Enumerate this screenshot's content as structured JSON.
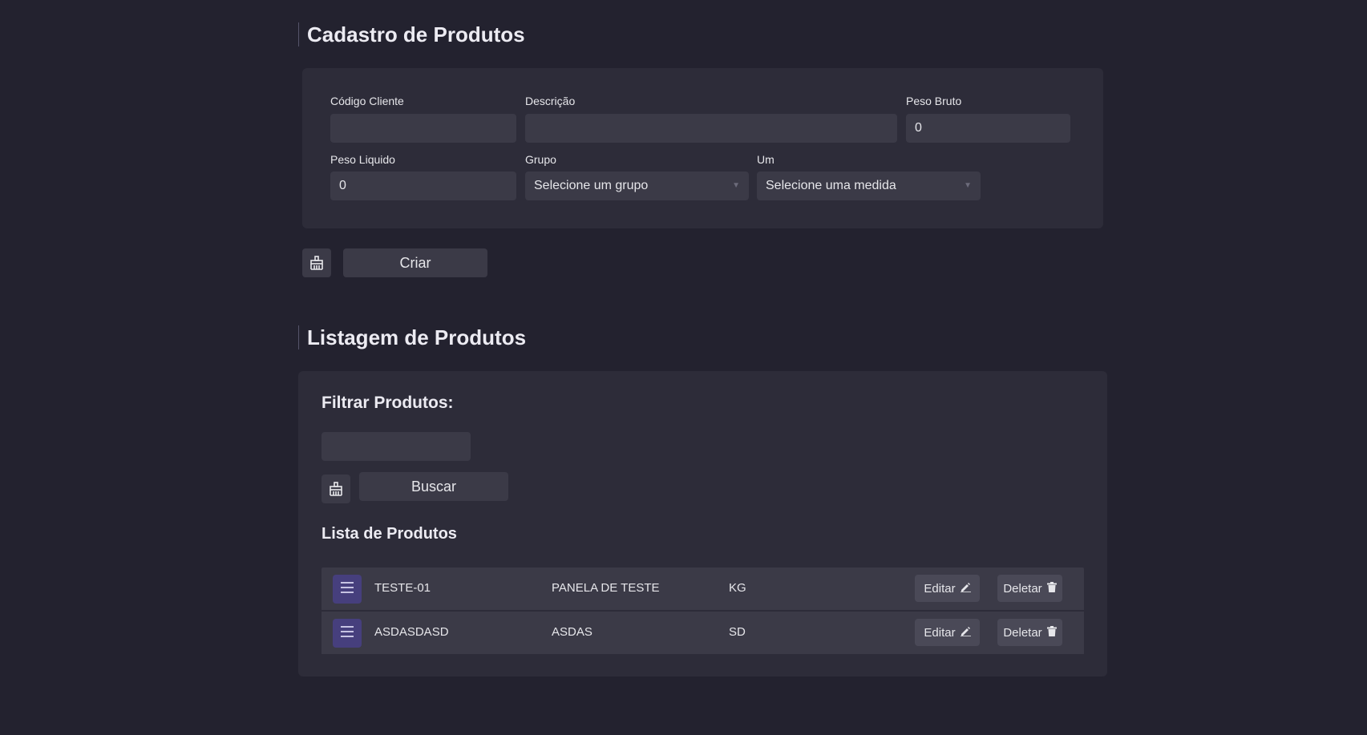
{
  "cadastro": {
    "title": "Cadastro de Produtos",
    "fields": {
      "codigo_cliente": {
        "label": "Código Cliente",
        "value": ""
      },
      "descricao": {
        "label": "Descrição",
        "value": ""
      },
      "peso_bruto": {
        "label": "Peso Bruto",
        "value": "0"
      },
      "peso_liquido": {
        "label": "Peso Liquido",
        "value": "0"
      },
      "grupo": {
        "label": "Grupo",
        "selected": "Selecione um grupo"
      },
      "um": {
        "label": "Um",
        "selected": "Selecione uma medida"
      }
    },
    "clear_icon": "broom-icon",
    "create_label": "Criar"
  },
  "listagem": {
    "title": "Listagem de Produtos",
    "filter_title": "Filtrar Produtos:",
    "filter_value": "",
    "clear_icon": "broom-icon",
    "search_label": "Buscar",
    "list_title": "Lista de Produtos",
    "items": [
      {
        "codigo": "TESTE-01",
        "descricao": "PANELA DE TESTE",
        "um": "KG",
        "edit_label": "Editar",
        "delete_label": "Deletar"
      },
      {
        "codigo": "ASDASDASD",
        "descricao": "ASDAS",
        "um": "SD",
        "edit_label": "Editar",
        "delete_label": "Deletar"
      }
    ]
  },
  "colors": {
    "background": "#23222f",
    "panel": "#2d2c39",
    "input": "#3b3a47",
    "accent": "#463f7d"
  }
}
